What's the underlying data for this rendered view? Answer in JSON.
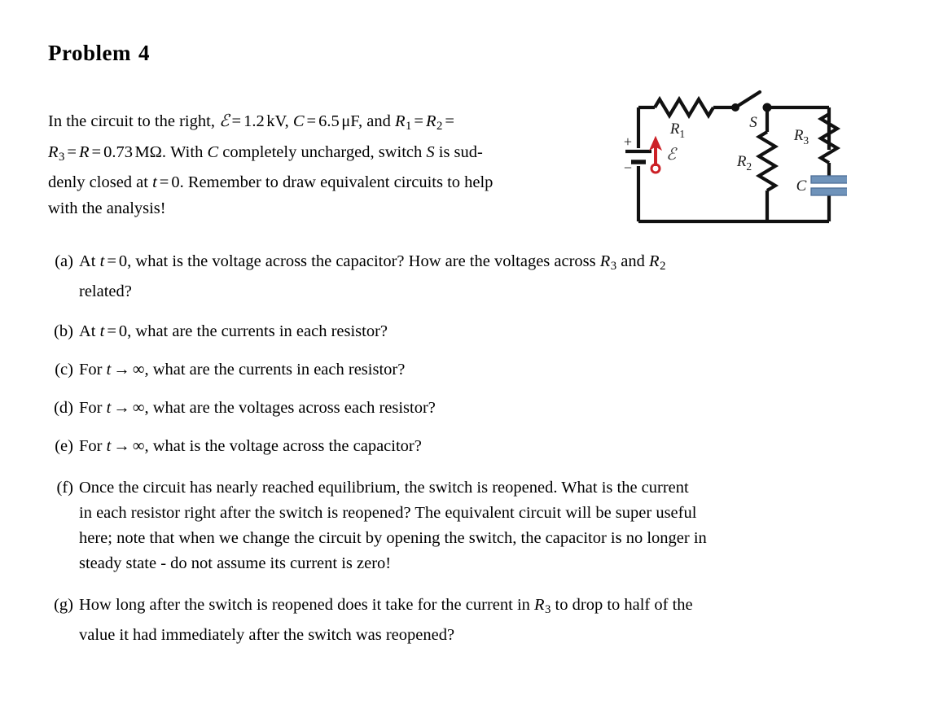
{
  "document": {
    "title_word": "Problem",
    "title_number": "4"
  },
  "intro": {
    "line1_a": "In the circuit to the right,",
    "emf_symbol": "ℰ",
    "eq": "=",
    "emf_value": "1.2",
    "emf_unit": "kV",
    "comma1": ",",
    "cap_symbol": "C",
    "cap_value": "6.5",
    "cap_unit": "μF",
    "comma2": ",",
    "and": "and",
    "r1_symbol": "R",
    "r1_sub": "1",
    "r2_symbol": "R",
    "r2_sub": "2",
    "line2_a": "R",
    "r3_sub": "3",
    "r_symbol": "R",
    "r_value": "0.73",
    "r_unit": "MΩ",
    "period": ".",
    "line2_b": "With",
    "c_symbol2": "C",
    "line2_c": "completely uncharged, switch",
    "s_symbol": "S",
    "line2_d": "is sud-",
    "line3_a": "denly closed at",
    "t_symbol": "t",
    "t_value": "0",
    "line3_b": "Remember to draw equivalent circuits to help",
    "line4": "with the analysis!"
  },
  "questions": [
    {
      "tag": "(a)",
      "lines": [
        "At t = 0, what is the voltage across the capacitor?  How are the voltages across R3 and R2",
        "related?"
      ],
      "parts": {
        "l1_p1": "At",
        "l1_t": "t",
        "l1_eq": "=",
        "l1_zero": "0",
        "l1_p2": ", what is the voltage across the capacitor?  How are the voltages across",
        "l1_r3": "R",
        "l1_r3sub": "3",
        "l1_and": "and",
        "l1_r2": "R",
        "l1_r2sub": "2",
        "l2": "related?"
      }
    },
    {
      "tag": "(b)",
      "parts": {
        "p1": "At",
        "t": "t",
        "eq": "=",
        "zero": "0",
        "p2": ", what are the currents in each resistor?"
      }
    },
    {
      "tag": "(c)",
      "parts": {
        "p1": "For",
        "t": "t",
        "arrow": "→",
        "inf": "∞",
        "p2": ", what are the currents in each resistor?"
      }
    },
    {
      "tag": "(d)",
      "parts": {
        "p1": "For",
        "t": "t",
        "arrow": "→",
        "inf": "∞",
        "p2": ", what are the voltages across each resistor?"
      }
    },
    {
      "tag": "(e)",
      "parts": {
        "p1": "For",
        "t": "t",
        "arrow": "→",
        "inf": "∞",
        "p2": ", what is the voltage across the capacitor?"
      }
    },
    {
      "tag": "(f)",
      "parts": {
        "l1": "Once the circuit has nearly reached equilibrium, the switch is reopened.  What is the current",
        "l2": "in each resistor right after the switch is reopened?  The equivalent circuit will be super useful",
        "l3": "here; note that when we change the circuit by opening the switch, the capacitor is no longer in",
        "l4": "steady state - do not assume its current is zero!"
      }
    },
    {
      "tag": "(g)",
      "parts": {
        "l1_p1": "How long after the switch is reopened does it take for the current in",
        "l1_r3": "R",
        "l1_r3sub": "3",
        "l1_p2": "to drop to half of the",
        "l2": "value it had immediately after the switch was reopened?"
      }
    }
  ],
  "circuit": {
    "labels": {
      "r1": "R",
      "r1_sub": "1",
      "r2": "R",
      "r2_sub": "2",
      "r3": "R",
      "r3_sub": "3",
      "c": "C",
      "s": "S",
      "emf": "ℰ",
      "battery_plus": "+",
      "battery_minus": "−"
    },
    "colors": {
      "wire": "#111111",
      "emf_arrow": "#cc2127",
      "capacitor_plate": "#6f93ba",
      "capacitor_plate_edge": "#4e7099",
      "label": "#1a1a1a"
    },
    "state": {
      "switch": "open",
      "capacitor": "uncharged"
    }
  }
}
